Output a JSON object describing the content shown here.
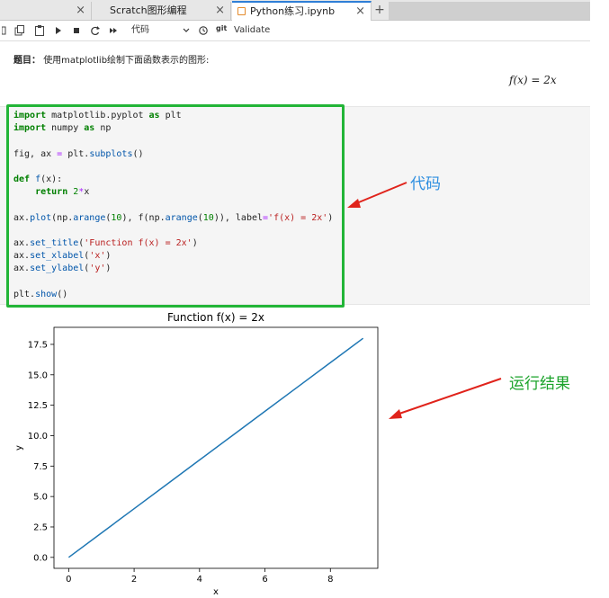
{
  "tabs": [
    {
      "label": "",
      "close": "×"
    },
    {
      "label": "Scratch图形编程",
      "close": "×"
    },
    {
      "label": "Python练习.ipynb",
      "close": "×"
    }
  ],
  "tab_add": "+",
  "toolbar": {
    "cell_type": "代码",
    "git_label": "git",
    "validate_label": "Validate",
    "icons": [
      "copy-icon",
      "paste-icon",
      "run-icon",
      "stop-icon",
      "restart-icon",
      "fast-forward-icon",
      "chevron-down-icon",
      "clock-icon"
    ]
  },
  "markdown": {
    "prefix": "题目：",
    "text": "使用matplotlib绘制下面函数表示的图形:",
    "formula": "f(x) = 2x"
  },
  "code_lines": [
    "import matplotlib.pyplot as plt",
    "import numpy as np",
    "",
    "fig, ax = plt.subplots()",
    "",
    "def f(x):",
    "    return 2*x",
    "",
    "ax.plot(np.arange(10), f(np.arange(10)), label='f(x) = 2x')",
    "",
    "ax.set_title('Function f(x) = 2x')",
    "ax.set_xlabel('x')",
    "ax.set_ylabel('y')",
    "",
    "plt.show()"
  ],
  "annotations": {
    "code_label": "代码",
    "result_label": "运行结果",
    "code_color": "#2f8fe0",
    "result_color": "#1aa32a",
    "arrow_color": "#e0231b"
  },
  "chart_data": {
    "type": "line",
    "title": "Function f(x) = 2x",
    "xlabel": "x",
    "ylabel": "y",
    "x": [
      0,
      1,
      2,
      3,
      4,
      5,
      6,
      7,
      8,
      9
    ],
    "series": [
      {
        "values": [
          0,
          2,
          4,
          6,
          8,
          10,
          12,
          14,
          16,
          18
        ],
        "color": "#1f77b4"
      }
    ],
    "xlim": [
      -0.45,
      9.45
    ],
    "ylim": [
      -0.9,
      18.9
    ],
    "xticks": [
      0,
      2,
      4,
      6,
      8
    ],
    "yticks": [
      0.0,
      2.5,
      5.0,
      7.5,
      10.0,
      12.5,
      15.0,
      17.5
    ],
    "ytick_labels": [
      "0.0",
      "2.5",
      "5.0",
      "7.5",
      "10.0",
      "12.5",
      "15.0",
      "17.5"
    ],
    "grid": false
  }
}
